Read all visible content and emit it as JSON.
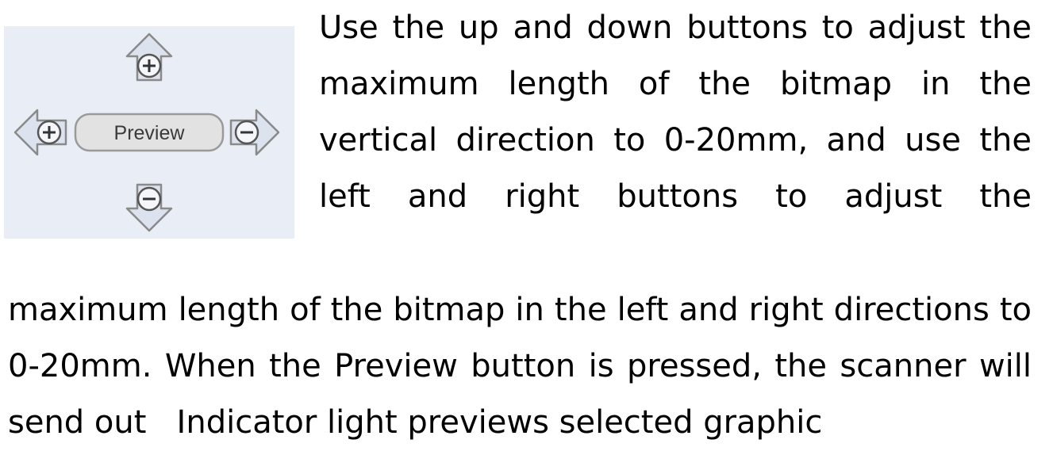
{
  "control_panel": {
    "preview_label": "Preview",
    "colors": {
      "panel_bg": "#e9edf6",
      "arrow_fill": "#dde3ee",
      "arrow_stroke": "#8a8a8a",
      "button_fill": "#e2e2e2",
      "button_stroke": "#9a9a9a"
    },
    "icons": {
      "up": "plus-circle-icon",
      "down": "minus-circle-icon",
      "left": "plus-circle-icon",
      "right": "minus-circle-icon"
    }
  },
  "paragraph": {
    "lines": [
      "Use the up and down buttons to adjust the",
      "maximum length of the bitmap in the",
      "vertical direction to 0-20mm, and use the",
      "left and right buttons to adjust the",
      "maximum length of the bitmap in the left and right directions to",
      "0-20mm. When the Preview button is pressed, the scanner will",
      "send out   Indicator light previews selected graphic"
    ]
  }
}
